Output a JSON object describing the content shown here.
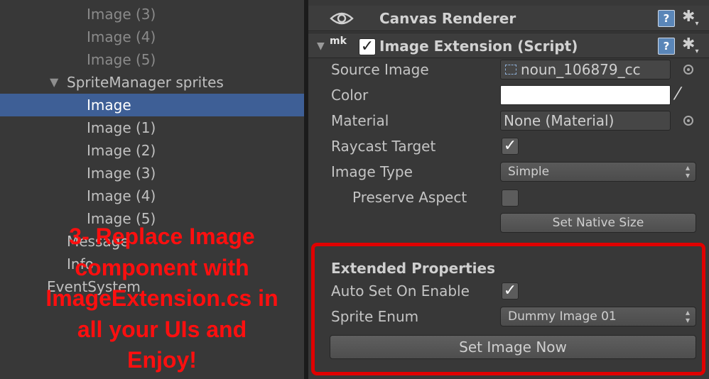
{
  "hierarchy": {
    "items": [
      {
        "label": "Image (3)"
      },
      {
        "label": "Image (4)"
      },
      {
        "label": "Image (5)"
      },
      {
        "label": "SpriteManager sprites"
      },
      {
        "label": "Image"
      },
      {
        "label": "Image (1)"
      },
      {
        "label": "Image (2)"
      },
      {
        "label": "Image (3)"
      },
      {
        "label": "Image (4)"
      },
      {
        "label": "Image (5)"
      },
      {
        "label": "Message"
      },
      {
        "label": "Info"
      },
      {
        "label": "EventSystem"
      }
    ],
    "arrow": "▼"
  },
  "inspector": {
    "canvas_renderer": {
      "title": "Canvas Renderer",
      "help": "?",
      "gear": "✱"
    },
    "image_extension": {
      "title": "Image Extension (Script)",
      "script_tag": "mk",
      "enabled_check": "✓",
      "help": "?",
      "gear": "✱",
      "source_image": {
        "label": "Source Image",
        "value": "noun_106879_cc"
      },
      "color": {
        "label": "Color",
        "value": "#ffffff"
      },
      "material": {
        "label": "Material",
        "value": "None (Material)"
      },
      "raycast_target": {
        "label": "Raycast Target",
        "check": "✓"
      },
      "image_type": {
        "label": "Image Type",
        "value": "Simple"
      },
      "preserve_aspect": {
        "label": "Preserve Aspect",
        "check": ""
      },
      "set_native_size": {
        "label": "Set Native Size"
      },
      "extended": {
        "heading": "Extended Properties",
        "auto_set_on_enable": {
          "label": "Auto Set On Enable",
          "check": "✓"
        },
        "sprite_enum": {
          "label": "Sprite Enum",
          "value": "Dummy Image 01"
        },
        "set_image_now": {
          "label": "Set Image Now"
        }
      }
    }
  },
  "annotation": {
    "lines": [
      "3- Replace Image",
      "component with",
      "ImageExtension.cs in",
      "all your UIs and",
      "Enjoy!"
    ],
    "color": "#ff0f0f"
  },
  "colors": {
    "selection": "#3e5f96",
    "highlight": "#e00000",
    "panel": "#383838"
  }
}
